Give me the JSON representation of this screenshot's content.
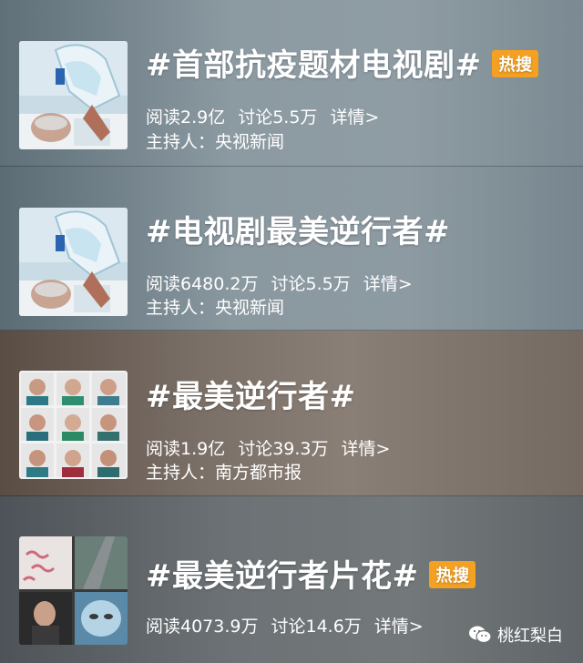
{
  "topics": [
    {
      "title": "#首部抗疫题材电视剧#",
      "badge": "热搜",
      "reads": "阅读2.9亿",
      "discuss": "讨论5.5万",
      "details": "详情>",
      "host": "主持人：央视新闻"
    },
    {
      "title": "#电视剧最美逆行者#",
      "reads": "阅读6480.2万",
      "discuss": "讨论5.5万",
      "details": "详情>",
      "host": "主持人：央视新闻"
    },
    {
      "title": "#最美逆行者#",
      "reads": "阅读1.9亿",
      "discuss": "讨论39.3万",
      "details": "详情>",
      "host": "主持人：南方都市报"
    },
    {
      "title": "#最美逆行者片花#",
      "badge": "热搜",
      "reads": "阅读4073.9万",
      "discuss": "讨论14.6万",
      "details": "详情>"
    }
  ],
  "watermark": {
    "label": "桃红梨白",
    "icon": "wechat-icon"
  },
  "colors": {
    "badge": "#f3a023",
    "text": "#ffffff"
  }
}
